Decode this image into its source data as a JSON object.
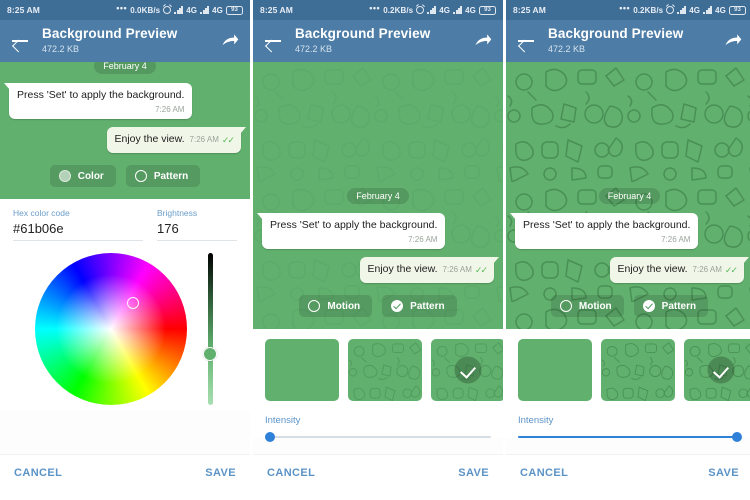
{
  "theme": {
    "statusbar_bg": "#3e6d96",
    "appbar_bg": "#4d7da6",
    "chat_green": "#61b06e",
    "accent_blue": "#5b93c7",
    "slider_blue": "#2f80d8",
    "incoming_bubble": "#ffffff",
    "outgoing_bubble": "#f0f7e8"
  },
  "panels": [
    {
      "id": "panel-color",
      "statusbar": {
        "time": "8:25 AM",
        "dots": "•••",
        "speed": "0.0KB/s",
        "alarm_icon": "alarm-icon",
        "signal1_label": "4G",
        "signal2_label": "4G",
        "battery": "93"
      },
      "appbar": {
        "back_icon": "back-arrow-icon",
        "title": "Background Preview",
        "subtitle": "472.2 KB",
        "share_icon": "share-icon"
      },
      "chat": {
        "day_pill": "February 4",
        "incoming": {
          "text": "Press 'Set' to apply the background.",
          "time": "7:26 AM"
        },
        "outgoing": {
          "text": "Enjoy the view.",
          "time": "7:26 AM",
          "ticks": "✓✓"
        },
        "toggles": [
          {
            "label": "Color",
            "state": "filled"
          },
          {
            "label": "Pattern",
            "state": "empty"
          }
        ]
      },
      "editor": {
        "type": "color",
        "hex_label": "Hex color code",
        "hex_value": "#61b06e",
        "brightness_label": "Brightness",
        "brightness_value": "176",
        "wheel_name": "color-wheel",
        "brightness_slider_name": "brightness-slider"
      },
      "footer": {
        "cancel": "CANCEL",
        "save": "SAVE"
      }
    },
    {
      "id": "panel-pattern-low",
      "statusbar": {
        "time": "8:25 AM",
        "dots": "•••",
        "speed": "0.2KB/s",
        "alarm_icon": "alarm-icon",
        "signal1_label": "4G",
        "signal2_label": "4G",
        "battery": "93"
      },
      "appbar": {
        "back_icon": "back-arrow-icon",
        "title": "Background Preview",
        "subtitle": "472.2 KB",
        "share_icon": "share-icon"
      },
      "chat": {
        "day_pill": "February 4",
        "incoming": {
          "text": "Press 'Set' to apply the background.",
          "time": "7:26 AM"
        },
        "outgoing": {
          "text": "Enjoy the view.",
          "time": "7:26 AM",
          "ticks": "✓✓"
        },
        "toggles": [
          {
            "label": "Motion",
            "state": "empty"
          },
          {
            "label": "Pattern",
            "state": "checked"
          }
        ]
      },
      "editor": {
        "type": "pattern",
        "intensity_label": "Intensity",
        "intensity_percent": 2,
        "selected_thumb_index": 2,
        "thumbs": [
          "plain",
          "doodle",
          "doodle",
          "doodle"
        ]
      },
      "footer": {
        "cancel": "CANCEL",
        "save": "SAVE"
      }
    },
    {
      "id": "panel-pattern-high",
      "statusbar": {
        "time": "8:25 AM",
        "dots": "•••",
        "speed": "0.2KB/s",
        "alarm_icon": "alarm-icon",
        "signal1_label": "4G",
        "signal2_label": "4G",
        "battery": "93"
      },
      "appbar": {
        "back_icon": "back-arrow-icon",
        "title": "Background Preview",
        "subtitle": "472.2 KB",
        "share_icon": "share-icon"
      },
      "chat": {
        "day_pill": "February 4",
        "incoming": {
          "text": "Press 'Set' to apply the background.",
          "time": "7:26 AM"
        },
        "outgoing": {
          "text": "Enjoy the view.",
          "time": "7:26 AM",
          "ticks": "✓✓"
        },
        "toggles": [
          {
            "label": "Motion",
            "state": "empty"
          },
          {
            "label": "Pattern",
            "state": "checked"
          }
        ]
      },
      "editor": {
        "type": "pattern",
        "intensity_label": "Intensity",
        "intensity_percent": 98,
        "selected_thumb_index": 2,
        "thumbs": [
          "plain",
          "doodle",
          "doodle",
          "doodle"
        ]
      },
      "footer": {
        "cancel": "CANCEL",
        "save": "SAVE"
      }
    }
  ]
}
